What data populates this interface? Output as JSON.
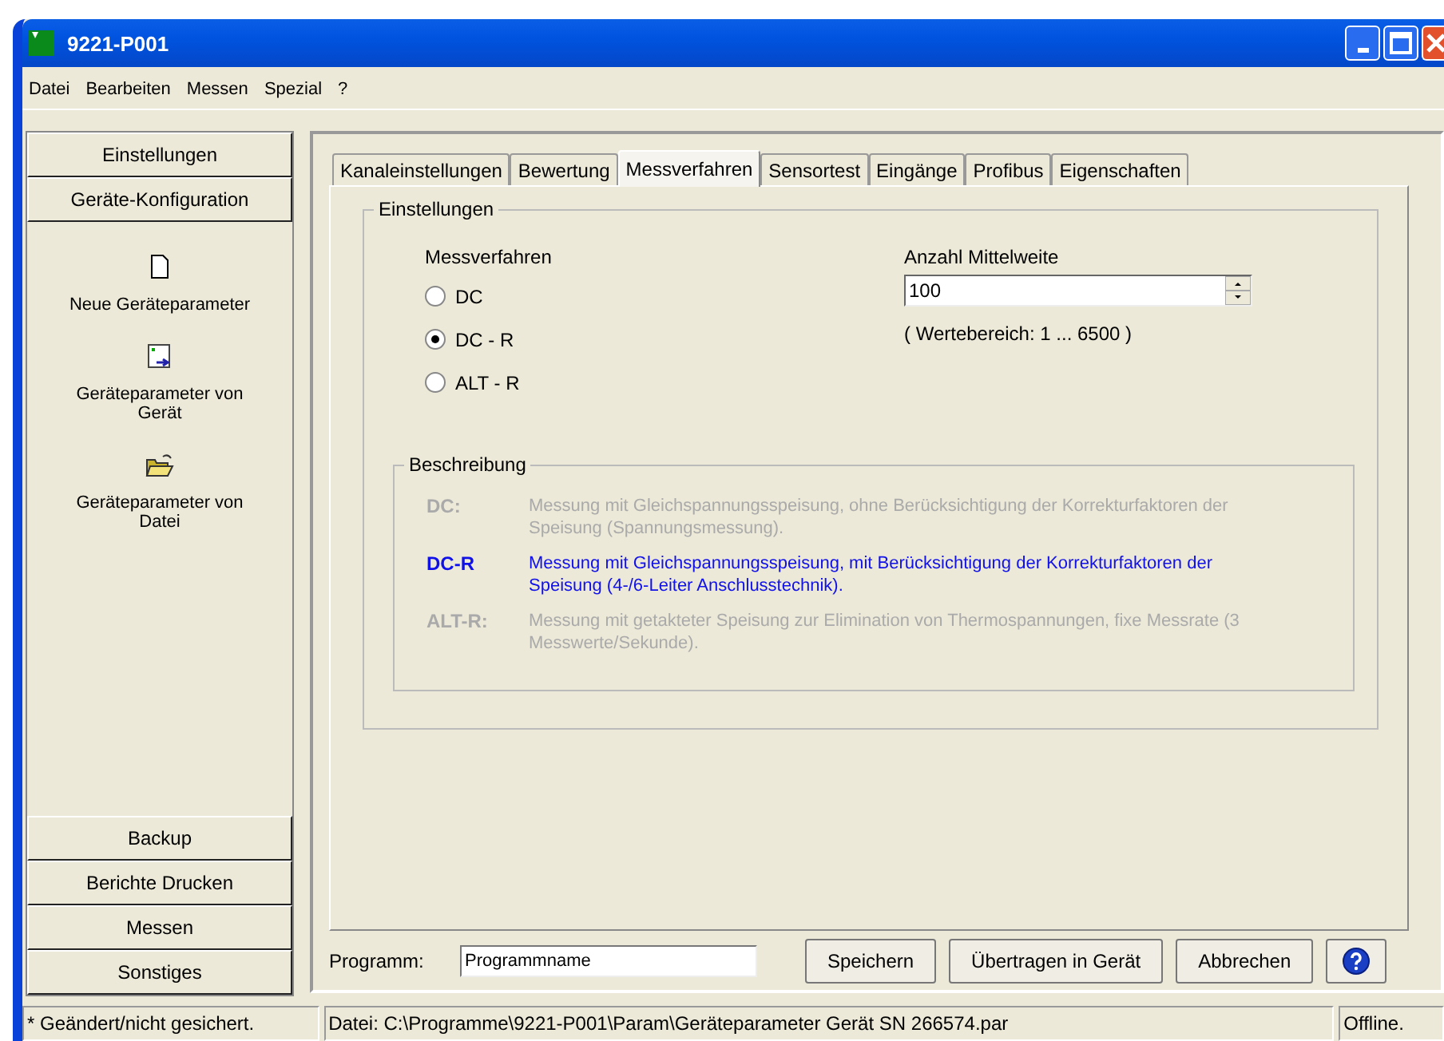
{
  "window": {
    "title": "9221-P001"
  },
  "menu": [
    "Datei",
    "Bearbeiten",
    "Messen",
    "Spezial",
    "?"
  ],
  "sidebar": {
    "top_buttons": [
      "Einstellungen",
      "Geräte-Konfiguration"
    ],
    "items": [
      {
        "kind": "new",
        "label": "Neue Geräteparameter"
      },
      {
        "kind": "device",
        "label": "Geräteparameter von Gerät"
      },
      {
        "kind": "file",
        "label": "Geräteparameter von Datei"
      }
    ],
    "bottom_buttons": [
      "Backup",
      "Berichte Drucken",
      "Messen",
      "Sonstiges"
    ]
  },
  "tabs": [
    {
      "label": "Kanaleinstellungen",
      "selected": false
    },
    {
      "label": "Bewertung",
      "selected": false
    },
    {
      "label": "Messverfahren",
      "selected": true
    },
    {
      "label": "Sensortest",
      "selected": false
    },
    {
      "label": "Eingänge",
      "selected": false
    },
    {
      "label": "Profibus",
      "selected": false
    },
    {
      "label": "Eigenschaften",
      "selected": false
    }
  ],
  "settings": {
    "title": "Einstellungen",
    "method_label": "Messverfahren",
    "methods": [
      {
        "label": "DC",
        "selected": false
      },
      {
        "label": "DC - R",
        "selected": true
      },
      {
        "label": "ALT - R",
        "selected": false
      }
    ],
    "average_label": "Anzahl Mittelweite",
    "average_value": "100",
    "range_hint": "( Wertebereich: 1 ... 6500 )"
  },
  "description": {
    "title": "Beschreibung",
    "entries": [
      {
        "term": "DC:",
        "text": "Messung mit Gleichspannungsspeisung, ohne Berücksichtigung der Korrekturfaktoren der Speisung (Spannungsmessung).",
        "highlighted": false
      },
      {
        "term": "DC-R",
        "text": "Messung mit Gleichspannungsspeisung, mit Berücksichtigung der Korrekturfaktoren der Speisung (4-/6-Leiter Anschlusstechnik).",
        "highlighted": true
      },
      {
        "term": "ALT-R:",
        "text": "Messung mit getakteter Speisung zur Elimination von Thermospannungen, fixe Messrate (3 Messwerte/Sekunde).",
        "highlighted": false
      }
    ]
  },
  "program": {
    "label": "Programm:",
    "value": "Programmname"
  },
  "buttons": [
    "Speichern",
    "Übertragen in Gerät",
    "Abbrechen"
  ],
  "status_bar": [
    "* Geändert/nicht gesichert.",
    "Datei: C:\\Programme\\9221-P001\\Param\\Geräteparameter Gerät SN 266574.par",
    "Offline."
  ]
}
